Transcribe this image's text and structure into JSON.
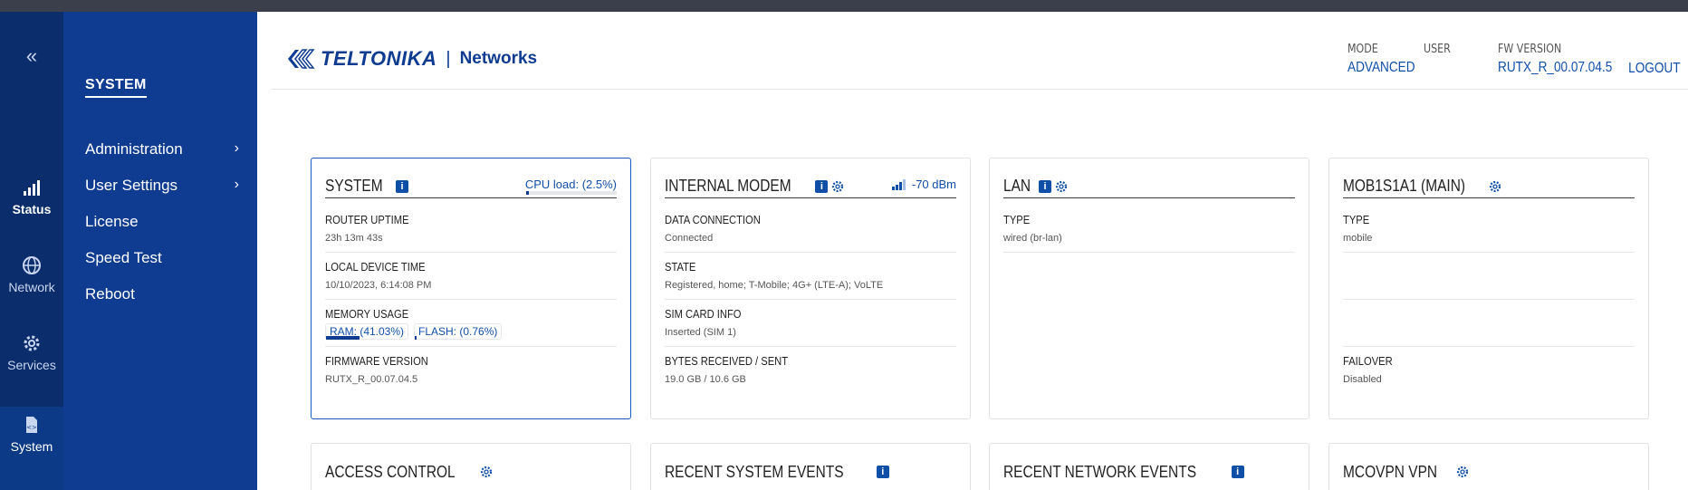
{
  "rail": {
    "collapse_glyph": "«",
    "items": [
      {
        "label": "Status",
        "icon": "signal-icon"
      },
      {
        "label": "Network",
        "icon": "globe-icon"
      },
      {
        "label": "Services",
        "icon": "gear-icon"
      },
      {
        "label": "System",
        "icon": "file-code-icon"
      }
    ]
  },
  "submenu": {
    "title": "SYSTEM",
    "items": [
      {
        "label": "Administration",
        "chevron": "›"
      },
      {
        "label": "User Settings",
        "chevron": "›"
      },
      {
        "label": "License"
      },
      {
        "label": "Speed Test"
      },
      {
        "label": "Reboot"
      }
    ]
  },
  "header": {
    "brand": "TELTONIKA",
    "separator": "|",
    "product": "Networks",
    "mode_label": "MODE",
    "mode_value": "ADVANCED",
    "user_label": "USER",
    "fw_label": "FW VERSION",
    "fw_value": "RUTX_R_00.07.04.5",
    "logout": "LOGOUT"
  },
  "cards": {
    "system": {
      "title": "SYSTEM",
      "cpu": "CPU load: (2.5%)",
      "cpu_fraction": 0.025,
      "rows": [
        {
          "k": "ROUTER UPTIME",
          "v": "23h 13m 43s"
        },
        {
          "k": "LOCAL DEVICE TIME",
          "v": "10/10/2023, 6:14:08 PM"
        },
        {
          "k": "MEMORY USAGE"
        },
        {
          "k": "FIRMWARE VERSION",
          "v": "RUTX_R_00.07.04.5"
        }
      ],
      "ram": "RAM: (41.03%)",
      "ram_fraction": 0.4103,
      "flash": "FLASH: (0.76%)",
      "flash_fraction": 0.0076
    },
    "modem": {
      "title": "INTERNAL MODEM",
      "signal": "-70 dBm",
      "rows": [
        {
          "k": "DATA CONNECTION",
          "v": "Connected"
        },
        {
          "k": "STATE",
          "v": "Registered, home; T-Mobile; 4G+ (LTE-A); VoLTE"
        },
        {
          "k": "SIM CARD INFO",
          "v": "Inserted (SIM 1)"
        },
        {
          "k": "BYTES RECEIVED / SENT",
          "v": "19.0 GB / 10.6 GB"
        }
      ]
    },
    "lan": {
      "title": "LAN",
      "rows": [
        {
          "k": "TYPE",
          "v": "wired (br-lan)"
        }
      ]
    },
    "mob": {
      "title": "MOB1S1A1 (MAIN)",
      "rows": [
        {
          "k": "TYPE",
          "v": "mobile"
        },
        {
          "k": "FAILOVER",
          "v": "Disabled"
        }
      ]
    },
    "access": {
      "title": "ACCESS CONTROL"
    },
    "sys_events": {
      "title": "RECENT SYSTEM EVENTS"
    },
    "net_events": {
      "title": "RECENT NETWORK EVENTS"
    },
    "vpn": {
      "title": "MCOVPN VPN"
    }
  },
  "colors": {
    "rail": "#0b2d6b",
    "submenu": "#0f3c91",
    "accent": "#0f4fa8"
  }
}
